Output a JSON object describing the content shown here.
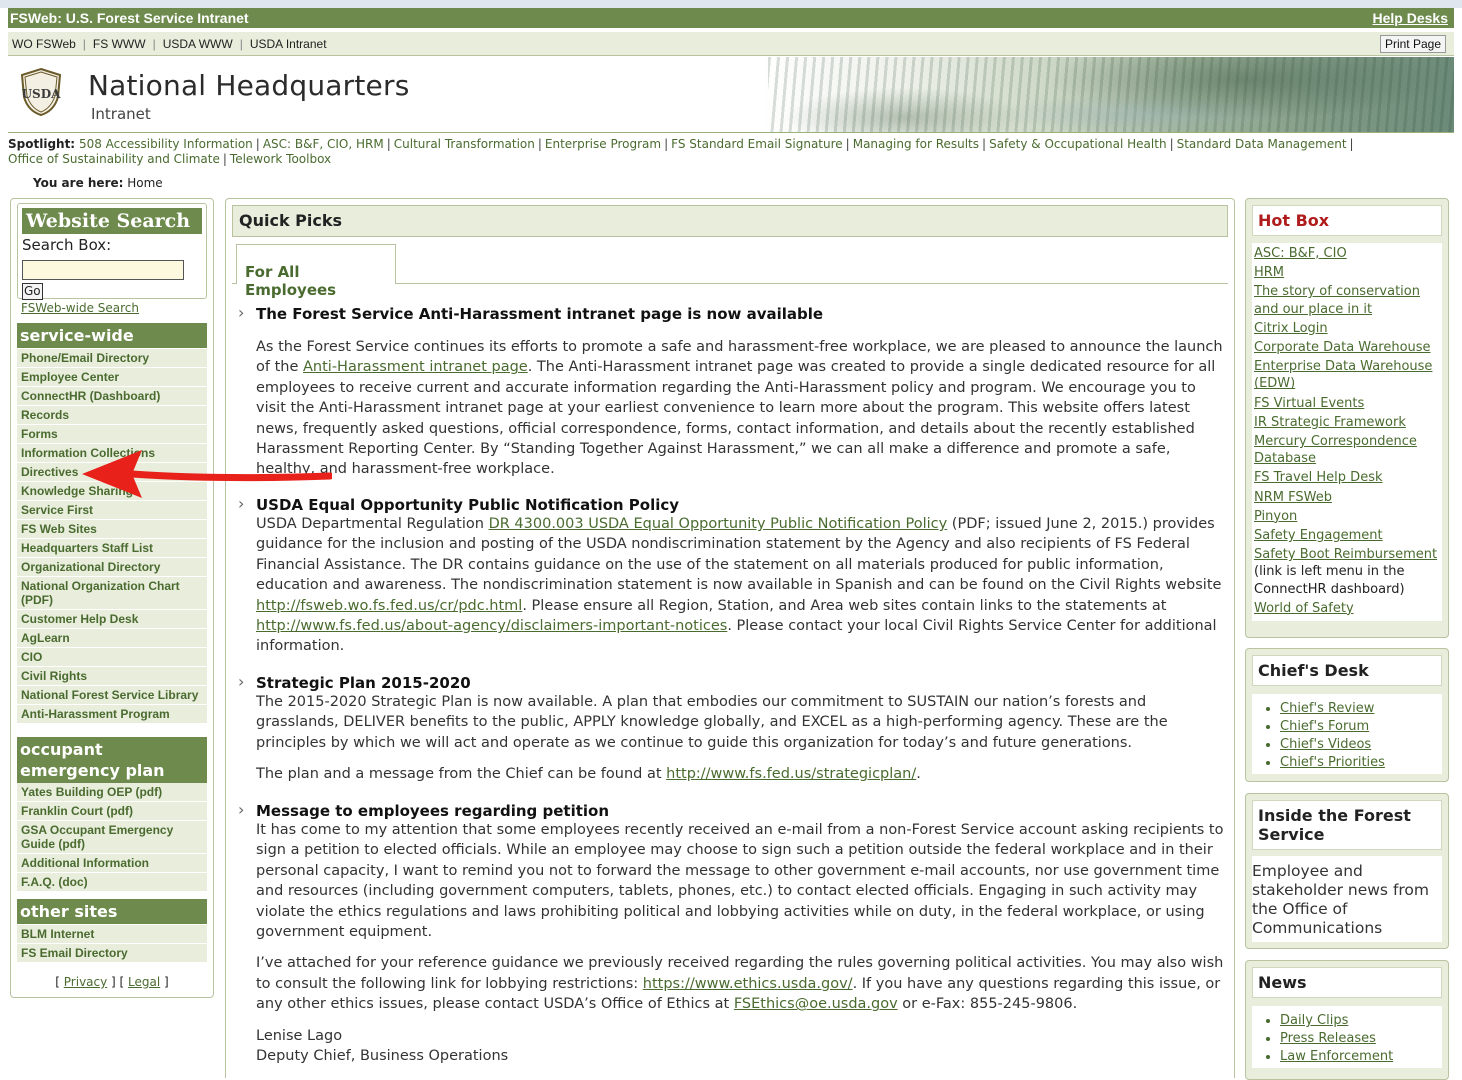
{
  "header": {
    "title": "FSWeb: U.S. Forest Service Intranet",
    "help_desks": "Help Desks"
  },
  "nav": {
    "links": [
      "WO FSWeb",
      "FS WWW",
      "USDA WWW",
      "USDA Intranet"
    ],
    "print_page": "Print Page"
  },
  "banner": {
    "logo_text": "USDA",
    "title": "National Headquarters",
    "subtitle": "Intranet"
  },
  "spotlight": {
    "label": "Spotlight:",
    "items": [
      "508 Accessibility Information",
      "ASC: B&F, CIO, HRM",
      "Cultural Transformation",
      "Enterprise Program",
      "FS Standard Email Signature",
      "Managing for Results",
      "Safety & Occupational Health",
      "Standard Data Management",
      "Office of Sustainability and Climate",
      "Telework Toolbox"
    ]
  },
  "breadcrumb": {
    "label": "You are here:",
    "current": "Home"
  },
  "search": {
    "heading": "Website Search",
    "label": "Search Box:",
    "placeholder": "",
    "go": "Go",
    "fsweb_wide": "FSWeb-wide Search"
  },
  "servicewide": {
    "heading": "service-wide",
    "items": [
      "Phone/Email Directory",
      "Employee Center",
      "ConnectHR (Dashboard)",
      "Records",
      "Forms",
      "Information Collections",
      "Directives",
      "Knowledge Sharing",
      "Service First",
      "FS Web Sites",
      "Headquarters Staff List",
      "Organizational Directory",
      "National Organization Chart (PDF)",
      "Customer Help Desk",
      "AgLearn",
      "CIO",
      "Civil Rights",
      "National Forest Service Library",
      "Anti-Harassment Program"
    ]
  },
  "oep": {
    "heading": "occupant emergency plan",
    "items": [
      "Yates Building OEP (pdf)",
      "Franklin Court (pdf)",
      "GSA Occupant Emergency Guide (pdf)",
      "Additional Information",
      "F.A.Q. (doc)"
    ]
  },
  "othersites": {
    "heading": "other sites",
    "items": [
      "BLM Internet",
      "FS Email Directory"
    ]
  },
  "footer": {
    "privacy": "Privacy",
    "legal": "Legal"
  },
  "quickpicks": {
    "heading": "Quick Picks",
    "tab": "For All Employees"
  },
  "articles": {
    "a1_title": "The Forest Service Anti-Harassment intranet page is now available",
    "a1_p1": "As the Forest Service continues its efforts to promote a safe and harassment-free workplace, we are pleased to announce the launch of the ",
    "a1_link": "Anti-Harassment intranet page",
    "a1_p2": ". The Anti-Harassment intranet page was created to provide a single dedicated resource for all employees to receive current and accurate information regarding the Anti-Harassment policy and program. We encourage you to visit the Anti-Harassment intranet page at your earliest convenience to learn more about the program. This website offers latest news, frequently asked questions, official correspondence, forms, contact information, and details about the recently established Harassment Reporting Center. By “Standing Together Against Harassment,” we can all make a difference and promote a safe, healthy, and harassment-free workplace.",
    "a2_title": "USDA Equal Opportunity Public Notification Policy",
    "a2_p1": "USDA Departmental Regulation ",
    "a2_link1": "DR 4300.003 USDA Equal Opportunity Public Notification Policy",
    "a2_p2": " (PDF; issued June 2, 2015.) provides guidance for the inclusion and posting of the USDA nondiscrimination statement by the Agency and also recipients of FS Federal Financial Assistance. The DR contains guidance on the use of the statement on all materials produced for public information, education and awareness. The nondiscrimination statement is now available in Spanish and can be found on the Civil Rights website ",
    "a2_link2": "http://fsweb.wo.fs.fed.us/cr/pdc.html",
    "a2_p3": ". Please ensure all Region, Station, and Area web sites contain links to the statements at ",
    "a2_link3": "http://www.fs.fed.us/about-agency/disclaimers-important-notices",
    "a2_p4": ". Please contact your local Civil Rights Service Center for additional information.",
    "a3_title": "Strategic Plan 2015-2020",
    "a3_p1": "The 2015-2020 Strategic Plan is now available. A plan that embodies our commitment to SUSTAIN our nation’s forests and grasslands, DELIVER benefits to the public, APPLY knowledge globally, and EXCEL as a high-performing agency. These are the principles by which we will act and operate as we continue to guide this organization for today’s and future generations.",
    "a3_p2": "The plan and a message from the Chief can be found at ",
    "a3_link": "http://www.fs.fed.us/strategicplan/",
    "a3_p3": ".",
    "a4_title": "Message to employees regarding petition",
    "a4_p1": "It has come to my attention that some employees recently received an e-mail from a non-Forest Service account asking recipients to sign a petition to elected officials. While an employee may choose to sign such a petition outside the federal workplace and in their personal capacity, I want to remind you not to forward the message to other government e-mail accounts, nor use government time and resources (including government computers, tablets, phones, etc.) to contact elected officials. Engaging in such activity may violate the ethics regulations and laws prohibiting political and lobbying activities while on duty, in the federal workplace, or using government equipment.",
    "a4_p2a": "I’ve attached for your reference guidance we previously received regarding the rules governing political activities. You may also wish to consult the following link for lobbying restrictions: ",
    "a4_link1": "https://www.ethics.usda.gov/",
    "a4_p2b": ". If you have any questions regarding this issue, or any other ethics issues, please contact USDA’s Office of Ethics at ",
    "a4_link2": "FSEthics@oe.usda.gov",
    "a4_p2c": " or e-Fax: 855-245-9806.",
    "a4_sig1": "Lenise Lago",
    "a4_sig2": "Deputy Chief, Business Operations"
  },
  "hotbox": {
    "heading": "Hot Box",
    "items": [
      "ASC: B&F, CIO",
      "HRM",
      "The story of conservation and our place in it",
      "Citrix Login",
      "Corporate Data Warehouse",
      "Enterprise Data Warehouse (EDW)",
      "FS Virtual Events",
      "IR Strategic Framework",
      "Mercury Correspondence Database",
      "FS Travel Help Desk",
      "NRM FSWeb",
      "Pinyon",
      "Safety Engagement",
      "Safety Boot Reimbursement",
      "World of Safety"
    ],
    "boot_note": " (link is left menu in the ConnectHR dashboard)"
  },
  "chiefsdesk": {
    "heading": "Chief's Desk",
    "items": [
      "Chief's Review",
      "Chief's Forum",
      "Chief's Videos",
      "Chief's Priorities"
    ]
  },
  "inside": {
    "heading": "Inside the Forest Service",
    "text": "Employee and stakeholder news from the Office of Communications"
  },
  "news": {
    "heading": "News",
    "items": [
      "Daily Clips",
      "Press Releases",
      "Law Enforcement"
    ]
  },
  "colors": {
    "green": "#6e8a4d",
    "light_green": "#e8eddc",
    "link": "#4a6b2f",
    "hotbox_red": "#b01c1c",
    "arrow_red": "#e8211a"
  }
}
